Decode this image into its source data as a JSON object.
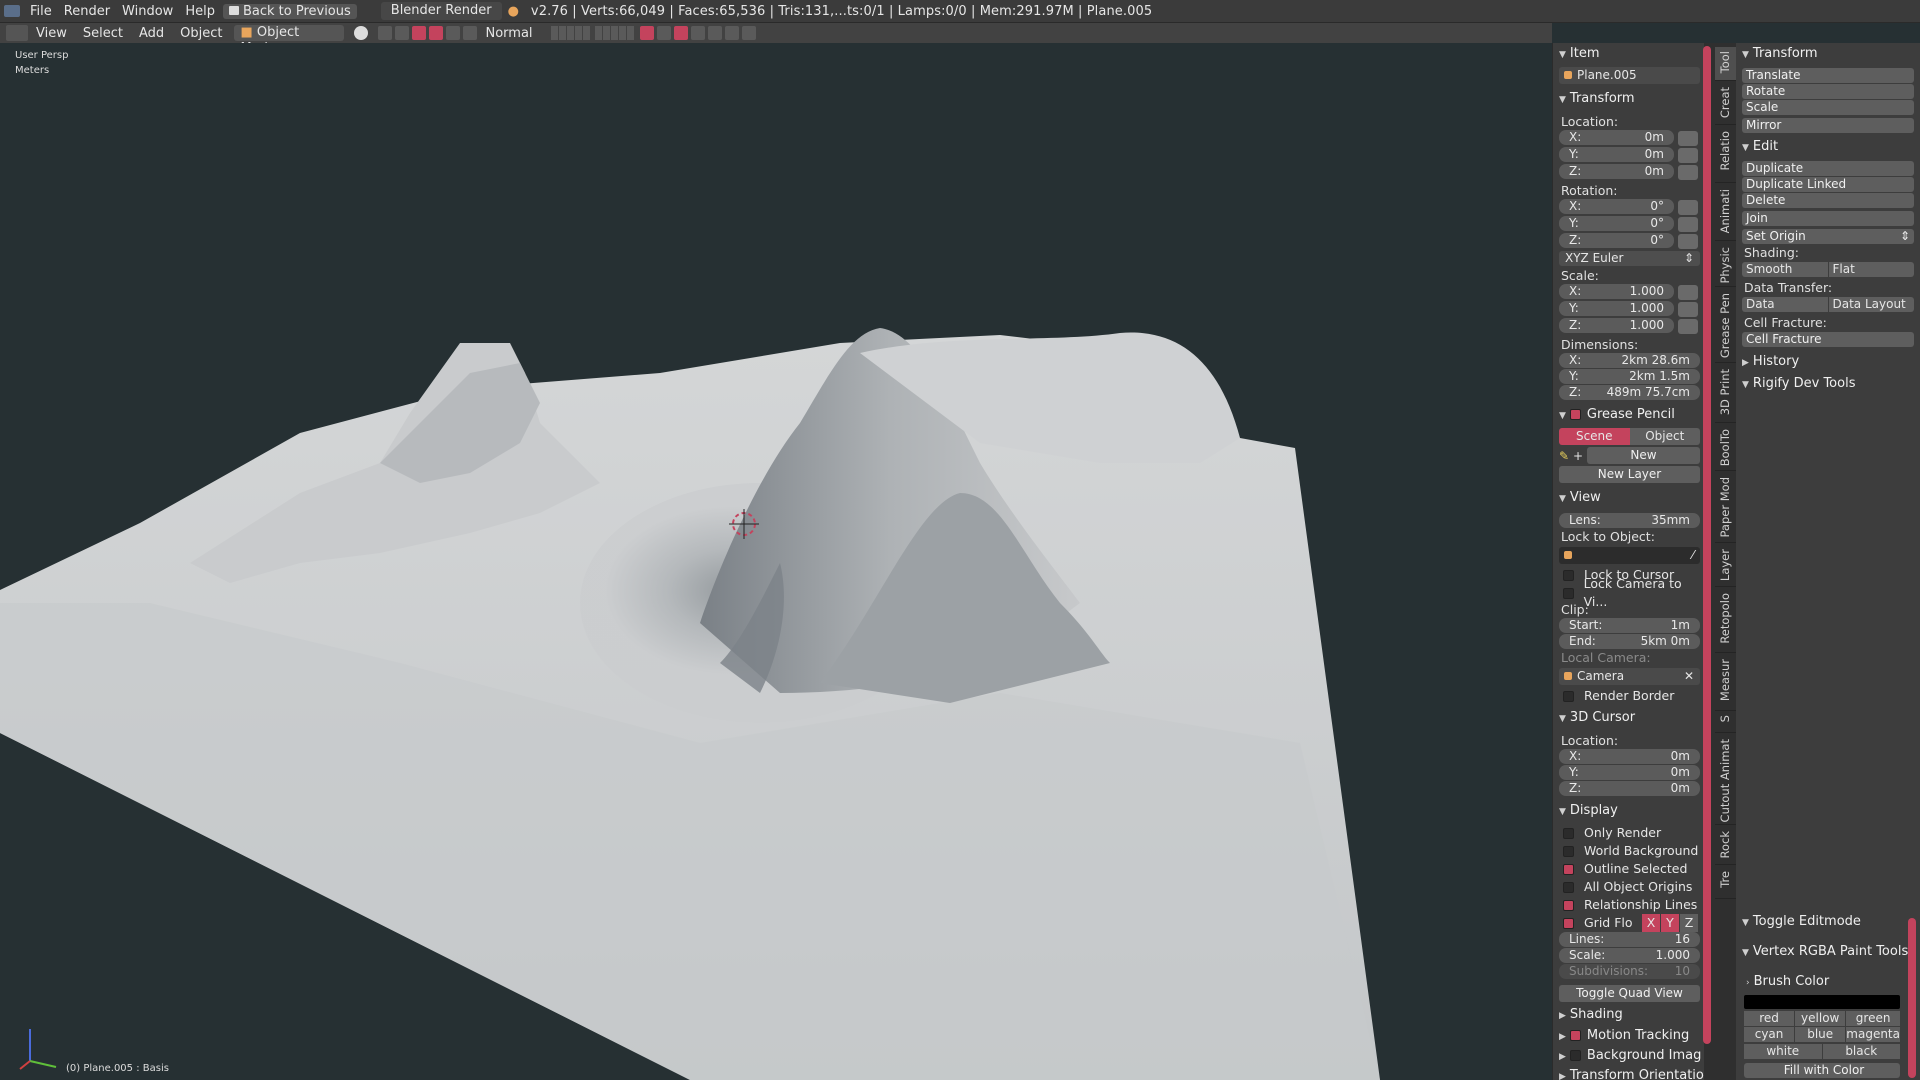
{
  "topbar": {
    "menus": [
      "File",
      "Render",
      "Window",
      "Help"
    ],
    "back_label": "Back to Previous",
    "engine": "Blender Render",
    "stats": "v2.76 | Verts:66,049 | Faces:65,536 | Tris:131,...ts:0/1 | Lamps:0/0 | Mem:291.97M | Plane.005"
  },
  "viewhdr": {
    "menus": [
      "View",
      "Select",
      "Add",
      "Object"
    ],
    "mode": "Object Mode",
    "pivot": "Normal"
  },
  "viewport": {
    "persp": "User Persp",
    "units": "Meters",
    "object_info": "(0) Plane.005 : Basis"
  },
  "npanel": {
    "item": {
      "title": "Item",
      "name": "Plane.005"
    },
    "transform": {
      "title": "Transform",
      "location_label": "Location:",
      "location": [
        "0m",
        "0m",
        "0m"
      ],
      "rotation_label": "Rotation:",
      "rotation": [
        "0°",
        "0°",
        "0°"
      ],
      "rotation_mode": "XYZ Euler",
      "scale_label": "Scale:",
      "scale": [
        "1.000",
        "1.000",
        "1.000"
      ],
      "dimensions_label": "Dimensions:",
      "dimensions": [
        "2km 28.6m",
        "2km 1.5m",
        "489m 75.7cm"
      ],
      "axes": [
        "X:",
        "Y:",
        "Z:"
      ]
    },
    "grease_pencil": {
      "title": "Grease Pencil",
      "scene": "Scene",
      "object": "Object",
      "new": "New",
      "new_layer": "New Layer"
    },
    "view": {
      "title": "View",
      "lens_label": "Lens:",
      "lens": "35mm",
      "lock_to_object": "Lock to Object:",
      "lock_to_cursor": "Lock to Cursor",
      "lock_camera": "Lock Camera to Vi...",
      "clip": "Clip:",
      "start_label": "Start:",
      "start": "1m",
      "end_label": "End:",
      "end": "5km 0m",
      "local_camera": "Local Camera:",
      "camera": "Camera",
      "render_border": "Render Border"
    },
    "cursor": {
      "title": "3D Cursor",
      "location_label": "Location:",
      "location": [
        "0m",
        "0m",
        "0m"
      ]
    },
    "display": {
      "title": "Display",
      "only_render": "Only Render",
      "world_background": "World Background",
      "outline_selected": "Outline Selected",
      "all_object_origins": "All Object Origins",
      "relationship_lines": "Relationship Lines",
      "grid_floor": "Grid Flo",
      "grid_axes": [
        "X",
        "Y",
        "Z"
      ],
      "lines_label": "Lines:",
      "lines": "16",
      "scale_label": "Scale:",
      "scale": "1.000",
      "subdiv_label": "Subdivisions:",
      "subdiv": "10",
      "toggle_quad": "Toggle Quad View"
    },
    "shading": "Shading",
    "motion_tracking": "Motion Tracking",
    "background_images": "Background Imag",
    "transform_orientations": "Transform Orientatio"
  },
  "tabs": [
    "Tool",
    "Creat",
    "Relatio",
    "Animati",
    "Physic",
    "Grease Pen",
    "3D Print",
    "BoolTo",
    "Paper Mod",
    "Layer",
    "Retopolo",
    "Measur",
    "S",
    "Cutout Animat",
    "Rock",
    "Tre"
  ],
  "tpanel": {
    "transform": {
      "title": "Transform",
      "translate": "Translate",
      "rotate": "Rotate",
      "scale": "Scale",
      "mirror": "Mirror"
    },
    "edit": {
      "title": "Edit",
      "duplicate": "Duplicate",
      "duplicate_linked": "Duplicate Linked",
      "delete": "Delete",
      "join": "Join",
      "set_origin": "Set Origin",
      "shading": "Shading:",
      "smooth": "Smooth",
      "flat": "Flat",
      "data_transfer": "Data Transfer:",
      "data": "Data",
      "data_layout": "Data Layout",
      "cell_fracture_label": "Cell Fracture:",
      "cell_fracture": "Cell Fracture"
    },
    "history": "History",
    "rigify": "Rigify Dev Tools",
    "toggle_editmode": "Toggle Editmode",
    "vertex_rgba": "Vertex RGBA Paint Tools",
    "brush_color": "Brush Color",
    "colors": [
      "red",
      "yellow",
      "green",
      "cyan",
      "blue",
      "magenta",
      "white",
      "black"
    ],
    "fill_with_color": "Fill with Color"
  }
}
